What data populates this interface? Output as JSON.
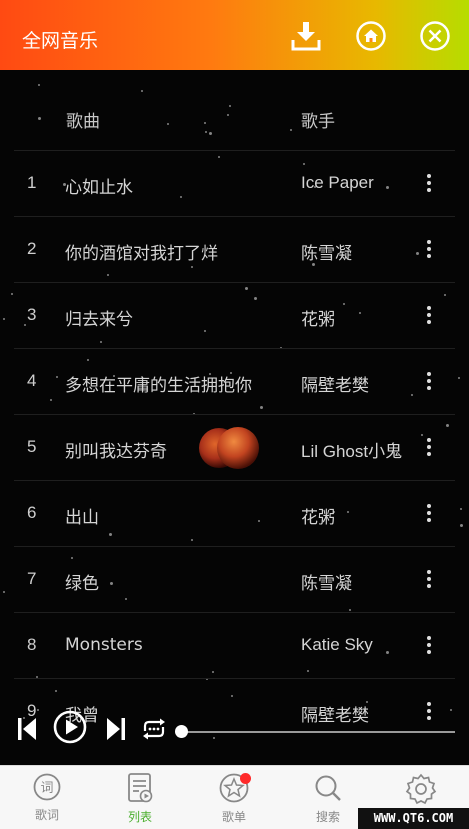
{
  "header": {
    "title": "全网音乐",
    "icons": [
      "download-icon",
      "home-icon",
      "close-icon"
    ]
  },
  "table": {
    "col_song": "歌曲",
    "col_artist": "歌手",
    "rows": [
      {
        "num": "1",
        "song": "心如止水",
        "artist": "Ice Paper"
      },
      {
        "num": "2",
        "song": "你的酒馆对我打了烊",
        "artist": "陈雪凝"
      },
      {
        "num": "3",
        "song": "归去来兮",
        "artist": "花粥"
      },
      {
        "num": "4",
        "song": "多想在平庸的生活拥抱你",
        "artist": "隔壁老樊"
      },
      {
        "num": "5",
        "song": "别叫我达芬奇",
        "artist": "Lil Ghost小鬼"
      },
      {
        "num": "6",
        "song": "出山",
        "artist": "花粥"
      },
      {
        "num": "7",
        "song": "绿色",
        "artist": "陈雪凝"
      },
      {
        "num": "8",
        "song": "Monsters",
        "artist": "Katie Sky"
      },
      {
        "num": "9",
        "song": "我曾",
        "artist": "隔壁老樊"
      }
    ]
  },
  "player": {
    "progress": 0,
    "icons": [
      "previous-icon",
      "play-icon",
      "next-icon",
      "loop-icon"
    ]
  },
  "nav": {
    "tabs": [
      {
        "label": "歌词",
        "icon": "lyrics-icon",
        "active": false
      },
      {
        "label": "列表",
        "icon": "list-icon",
        "active": true
      },
      {
        "label": "歌单",
        "icon": "playlist-star-icon",
        "active": false,
        "badge": true
      },
      {
        "label": "搜索",
        "icon": "search-icon",
        "active": false
      },
      {
        "label": "设置",
        "icon": "gear-icon",
        "active": false
      }
    ]
  },
  "watermark": "WWW.QT6.COM",
  "colors": {
    "header_start": "#ff4a12",
    "header_end": "#b6dd00",
    "active_tab": "#4caf2f",
    "badge": "#ff2a2a"
  }
}
